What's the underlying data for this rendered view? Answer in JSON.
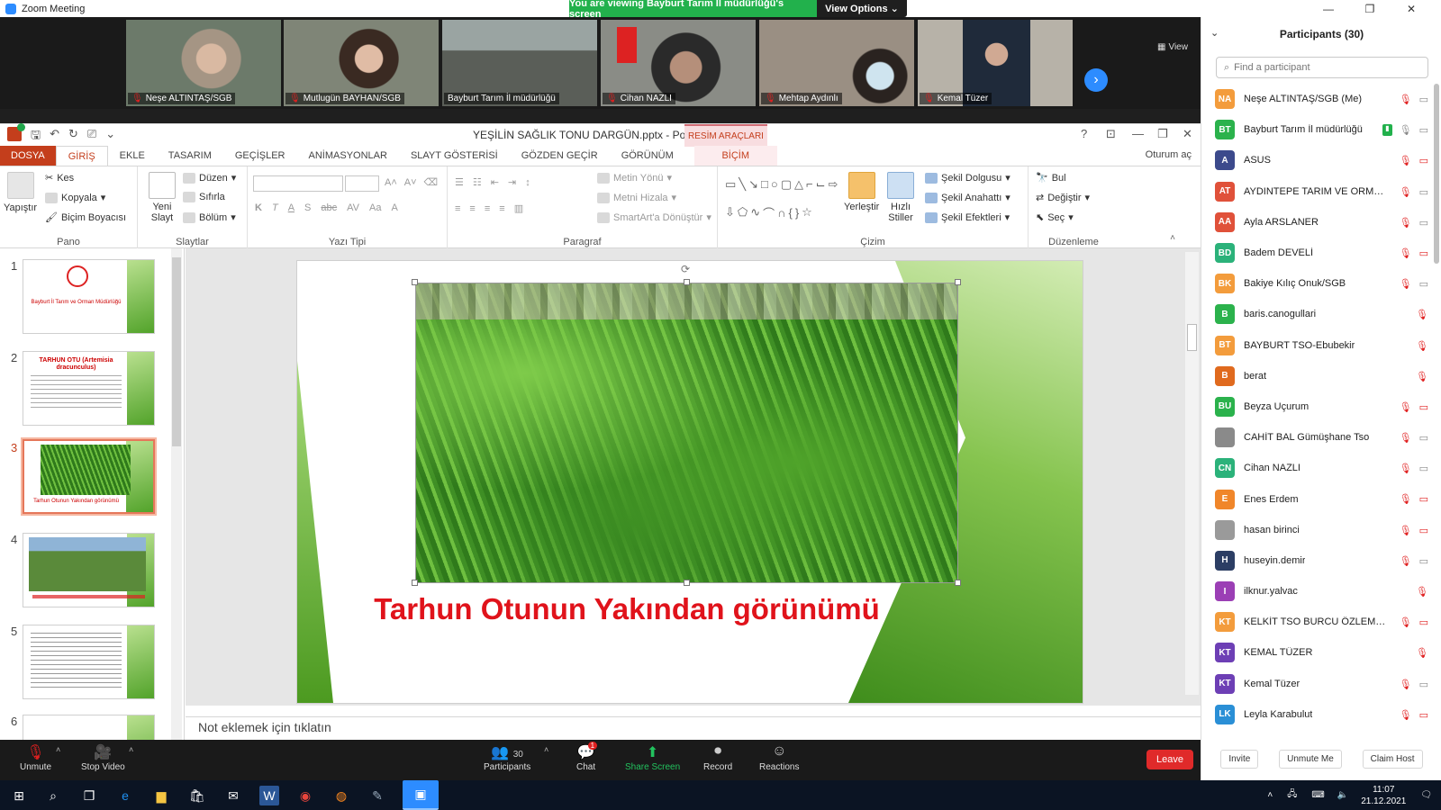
{
  "zoom": {
    "window_title": "Zoom Meeting",
    "viewing_banner": "You are viewing Bayburt Tarım İl müdürlüğü's screen",
    "view_options": "View Options",
    "view_label": "View",
    "tiles": [
      {
        "name": "Neşe ALTINTAŞ/SGB",
        "bg": "#6c7a6a"
      },
      {
        "name": "Mutlugün BAYHAN/SGB",
        "bg": "#7f8577"
      },
      {
        "name": "Bayburt Tarım İl müdürlüğü",
        "bg": "#575b55"
      },
      {
        "name": "Cihan NAZLI",
        "bg": "#8a8c86"
      },
      {
        "name": "Mehtap Aydınlı",
        "bg": "#9a8f83"
      },
      {
        "name": "Kemal Tüzer",
        "bg": "#b7b2a8"
      }
    ],
    "controls": {
      "unmute": "Unmute",
      "stop_video": "Stop Video",
      "participants": "Participants",
      "participants_count": "30",
      "chat": "Chat",
      "chat_badge": "1",
      "share_screen": "Share Screen",
      "record": "Record",
      "reactions": "Reactions",
      "leave": "Leave"
    }
  },
  "ppt": {
    "file_title": "YEŞİLİN SAĞLIK TONU DARGÜN.pptx - PowerPoint",
    "context_tab": "RESİM ARAÇLARI",
    "signin": "Oturum aç",
    "tabs": [
      "DOSYA",
      "GİRİŞ",
      "EKLE",
      "TASARIM",
      "GEÇİŞLER",
      "ANİMASYONLAR",
      "SLAYT GÖSTERİSİ",
      "GÖZDEN GEÇİR",
      "GÖRÜNÜM",
      "BİÇİM"
    ],
    "ribbon": {
      "pano": {
        "label": "Pano",
        "paste": "Yapıştır",
        "cut": "Kes",
        "copy": "Kopyala",
        "format_painter": "Biçim Boyacısı"
      },
      "slaytlar": {
        "label": "Slaytlar",
        "new_slide": "Yeni Slayt",
        "layout": "Düzen",
        "reset": "Sıfırla",
        "section": "Bölüm"
      },
      "yazi_tipi": {
        "label": "Yazı Tipi",
        "bold": "K",
        "italic": "T",
        "underline": "A",
        "shadow": "S",
        "strike": "abc",
        "spacing": "AV",
        "case": "Aa",
        "color": "A"
      },
      "paragraf": {
        "label": "Paragraf",
        "text_dir": "Metin Yönü",
        "align_text": "Metni Hizala",
        "smartart": "SmartArt'a Dönüştür"
      },
      "cizim": {
        "label": "Çizim",
        "arrange": "Yerleştir",
        "quick_styles": "Hızlı Stiller",
        "fill": "Şekil Dolgusu",
        "outline": "Şekil Anahattı",
        "effects": "Şekil Efektleri"
      },
      "duzenleme": {
        "label": "Düzenleme",
        "find": "Bul",
        "replace": "Değiştir",
        "select": "Seç"
      }
    },
    "thumbnails": [
      {
        "num": "1",
        "text": "Bayburt İl Tarım ve Orman Müdürlüğü"
      },
      {
        "num": "2",
        "text": "TARHUN OTU (Artemisia dracunculus)"
      },
      {
        "num": "3",
        "text": "Tarhun Otunun Yakından görünümü"
      },
      {
        "num": "4",
        "text": ""
      },
      {
        "num": "5",
        "text": ""
      },
      {
        "num": "6",
        "text": ""
      }
    ],
    "slide_caption": "Tarhun Otunun Yakından görünümü",
    "notes_placeholder": "Not eklemek için tıklatın"
  },
  "panel": {
    "title": "Participants (30)",
    "search_placeholder": "Find a participant",
    "participants": [
      {
        "initials": "NA",
        "name": "Neşe ALTINTAŞ/SGB (Me)",
        "color": "#f39c3c",
        "mic": "off",
        "cam": "on"
      },
      {
        "initials": "BT",
        "name": "Bayburt Tarım İl müdürlüğü",
        "color": "#2bb24c",
        "mic": "on",
        "cam": "on",
        "sharing": true
      },
      {
        "initials": "A",
        "name": "ASUS",
        "color": "#3c4a8c",
        "mic": "off",
        "cam": "off"
      },
      {
        "initials": "AT",
        "name": "AYDINTEPE TARIM VE ORMAN ...",
        "color": "#e0513a",
        "mic": "off",
        "cam": "on"
      },
      {
        "initials": "AA",
        "name": "Ayla ARSLANER",
        "color": "#e0513a",
        "mic": "off",
        "cam": "on"
      },
      {
        "initials": "BD",
        "name": "Badem DEVELİ",
        "color": "#2bb27a",
        "mic": "off",
        "cam": "off"
      },
      {
        "initials": "BK",
        "name": "Bakiye Kılıç Onuk/SGB",
        "color": "#f39c3c",
        "mic": "off",
        "cam": "on"
      },
      {
        "initials": "B",
        "name": "baris.canogullari",
        "color": "#2bb24c",
        "mic": "off",
        "cam": "none"
      },
      {
        "initials": "BT",
        "name": "BAYBURT TSO-Ebubekir",
        "color": "#f39c3c",
        "mic": "off",
        "cam": "none"
      },
      {
        "initials": "B",
        "name": "berat",
        "color": "#e06a1e",
        "mic": "off",
        "cam": "none"
      },
      {
        "initials": "BU",
        "name": "Beyza Uçurum",
        "color": "#2bb24c",
        "mic": "off",
        "cam": "off"
      },
      {
        "initials": "",
        "name": "CAHİT BAL Gümüşhane Tso",
        "color": "#8a8a8a",
        "mic": "off",
        "cam": "on"
      },
      {
        "initials": "CN",
        "name": "Cihan NAZLI",
        "color": "#2bb27a",
        "mic": "off",
        "cam": "on"
      },
      {
        "initials": "E",
        "name": "Enes Erdem",
        "color": "#f0862a",
        "mic": "off",
        "cam": "off"
      },
      {
        "initials": "",
        "name": "hasan birinci",
        "color": "#9a9a9a",
        "mic": "off",
        "cam": "off"
      },
      {
        "initials": "H",
        "name": "huseyin.demir",
        "color": "#2c3e64",
        "mic": "off",
        "cam": "on"
      },
      {
        "initials": "I",
        "name": "ilknur.yalvac",
        "color": "#9b3fb5",
        "mic": "off",
        "cam": "none"
      },
      {
        "initials": "KT",
        "name": "KELKİT TSO BURCU ÖZLEM SU...",
        "color": "#f39c3c",
        "mic": "off",
        "cam": "off"
      },
      {
        "initials": "KT",
        "name": "KEMAL TÜZER",
        "color": "#6d3fb5",
        "mic": "off",
        "cam": "none"
      },
      {
        "initials": "KT",
        "name": "Kemal Tüzer",
        "color": "#6d3fb5",
        "mic": "off",
        "cam": "on"
      },
      {
        "initials": "LK",
        "name": "Leyla Karabulut",
        "color": "#2a8fd6",
        "mic": "off",
        "cam": "off"
      }
    ],
    "invite": "Invite",
    "unmute_me": "Unmute Me",
    "claim_host": "Claim Host"
  },
  "taskbar": {
    "time": "11:07",
    "date": "21.12.2021"
  }
}
